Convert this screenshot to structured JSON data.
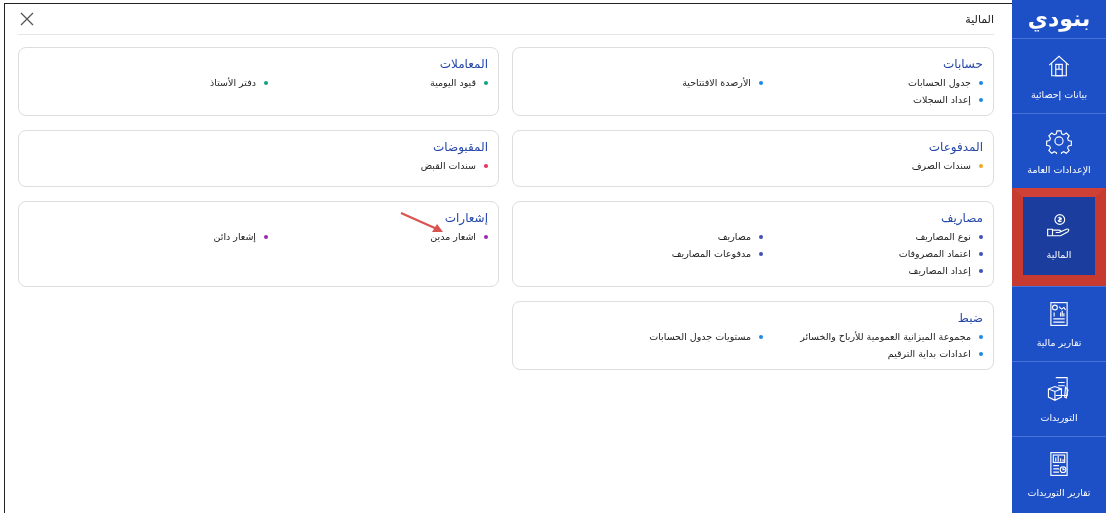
{
  "sidebar": {
    "brand": "بنودي",
    "items": [
      {
        "label": "بيانات إحصائية",
        "selected": false
      },
      {
        "label": "الإعدادات العامة",
        "selected": false
      },
      {
        "label": "المالية",
        "selected": true
      },
      {
        "label": "تقارير مالية",
        "selected": false
      },
      {
        "label": "التوريدات",
        "selected": false
      },
      {
        "label": "تقارير التوريدات",
        "selected": false
      }
    ]
  },
  "header": {
    "title": "المالية"
  },
  "sections": [
    {
      "title": "حسابات",
      "color": "#1e88e5",
      "items": [
        "جدول الحسابات",
        "الأرصدة الافتتاحية",
        "إعداد السجلات"
      ]
    },
    {
      "title": "المعاملات",
      "color": "#16a085",
      "items": [
        "قيود اليومية",
        "دفتر الأستاذ"
      ]
    },
    {
      "title": "المدفوعات",
      "color": "#f5a623",
      "items": [
        "سندات الصرف"
      ]
    },
    {
      "title": "المقبوضات",
      "color": "#e8325f",
      "items": [
        "سندات القبض"
      ]
    },
    {
      "title": "مصاريف",
      "color": "#3f51b5",
      "items": [
        "نوع المصاريف",
        "مصاريف",
        "اعتماد المصروفات",
        "مدفوعات المصاريف",
        "إعداد المصاريف"
      ]
    },
    {
      "title": "إشعارات",
      "color": "#9c27b0",
      "items": [
        "اشعار مدين",
        "إشعار دائن"
      ]
    },
    {
      "title": "ضبط",
      "color": "#1e88e5",
      "items": [
        "مجموعة الميزانية العمومية للأرباح والخسائر",
        "مستويات جدول الحسابات",
        "اعدادات بداية الترقيم"
      ]
    }
  ]
}
